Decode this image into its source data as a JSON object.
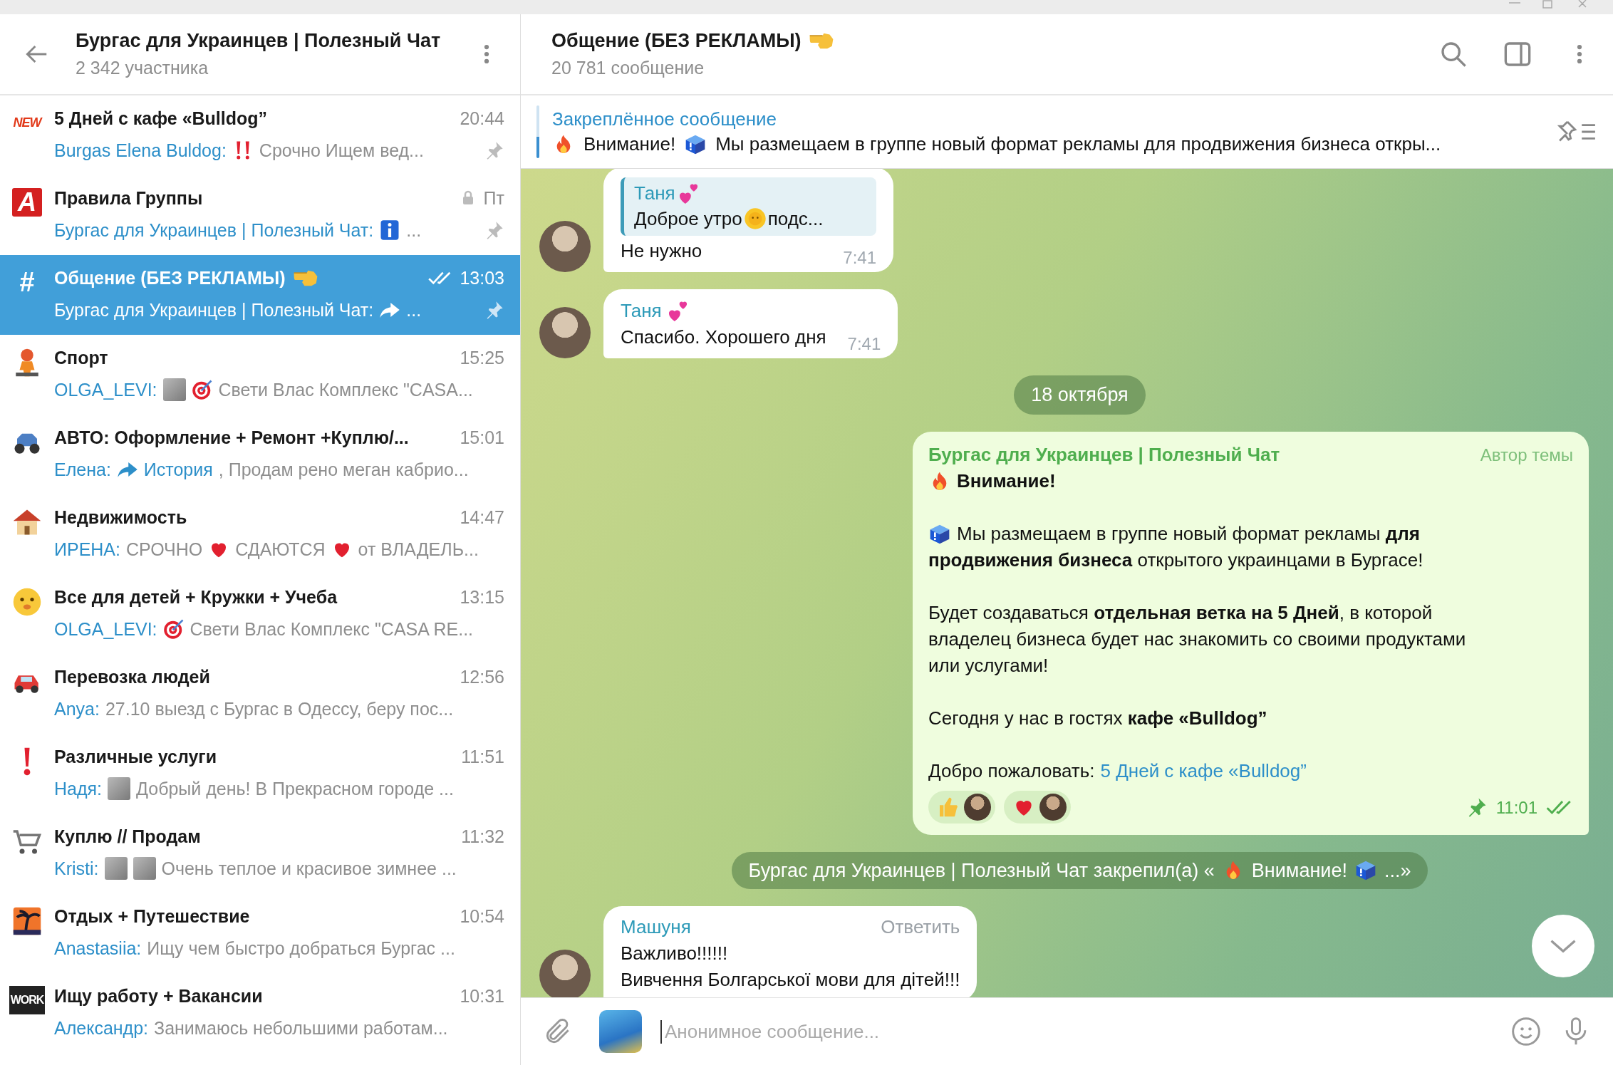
{
  "sidebar_header": {
    "title": "Бургас для Украинцев | Полезный Чат",
    "subtitle": "2 342 участника"
  },
  "topics": [
    {
      "icon_text": "NEW",
      "title": "5 Дней с кафе «Bulldog”",
      "time": "20:44",
      "sender": "Burgas Elena Buldog:",
      "preview": [
        {
          "kind": "exclaim"
        },
        {
          "kind": "text",
          "text": "Срочно Ищем вед..."
        }
      ],
      "pinned": true,
      "locked": false,
      "read": false,
      "selected": false
    },
    {
      "icon_text": "A",
      "title": "Правила Группы",
      "time": "Пт",
      "sender": "Бургас для Украинцев | Полезный Чат:",
      "preview": [
        {
          "kind": "info"
        },
        {
          "kind": "text",
          "text": "..."
        }
      ],
      "pinned": true,
      "locked": true,
      "read": false,
      "selected": false
    },
    {
      "icon_text": "#",
      "title": "Общение (БЕЗ РЕКЛАМЫ)",
      "title_icon": true,
      "time": "13:03",
      "sender": "Бургас для Украинцев | Полезный Чат:",
      "preview": [
        {
          "kind": "forward"
        },
        {
          "kind": "text",
          "text": "..."
        }
      ],
      "pinned": true,
      "locked": false,
      "read": true,
      "selected": true
    },
    {
      "title": "Спорт",
      "time": "15:25",
      "sender": "OLGA_LEVI:",
      "preview": [
        {
          "kind": "photo"
        },
        {
          "kind": "target"
        },
        {
          "kind": "text",
          "text": "Свети Влас  Комплекс \"CASA..."
        }
      ],
      "pinned": false,
      "locked": false,
      "read": false,
      "selected": false
    },
    {
      "title": "АВТО: Оформление + Ремонт +Куплю/...",
      "time": "15:01",
      "sender": "Елена:",
      "preview": [
        {
          "kind": "forward"
        },
        {
          "kind": "link",
          "text": "История"
        },
        {
          "kind": "text",
          "text": ", Продам рено меган кабрио..."
        }
      ],
      "pinned": false,
      "locked": false,
      "read": false,
      "selected": false
    },
    {
      "title": "Недвижимость",
      "time": "14:47",
      "sender": "ИРЕНА:",
      "preview": [
        {
          "kind": "text",
          "text": "СРОЧНО"
        },
        {
          "kind": "heart"
        },
        {
          "kind": "text",
          "text": "СДАЮТСЯ"
        },
        {
          "kind": "heart"
        },
        {
          "kind": "text",
          "text": "от  ВЛАДЕЛЬ..."
        }
      ],
      "pinned": false,
      "locked": false,
      "read": false,
      "selected": false
    },
    {
      "title": "Все для детей + Кружки + Учеба",
      "time": "13:15",
      "sender": "OLGA_LEVI:",
      "preview": [
        {
          "kind": "target"
        },
        {
          "kind": "text",
          "text": "Свети Влас  Комплекс \"CASA RE..."
        }
      ],
      "pinned": false,
      "locked": false,
      "read": false,
      "selected": false
    },
    {
      "title": "Перевозка людей",
      "time": "12:56",
      "sender": "Anya:",
      "preview": [
        {
          "kind": "text",
          "text": "27.10 выезд  с Бургас в Одессу, беру пос..."
        }
      ],
      "pinned": false,
      "locked": false,
      "read": false,
      "selected": false
    },
    {
      "title": "Различные услуги",
      "time": "11:51",
      "sender": "Надя:",
      "preview": [
        {
          "kind": "photo"
        },
        {
          "kind": "text",
          "text": "Добрый день! В Прекрасном городе ..."
        }
      ],
      "pinned": false,
      "locked": false,
      "read": false,
      "selected": false
    },
    {
      "title": "Куплю // Продам",
      "time": "11:32",
      "sender": "Kristi:",
      "preview": [
        {
          "kind": "photo"
        },
        {
          "kind": "photo"
        },
        {
          "kind": "text",
          "text": "Очень теплое и красивое зимнее ..."
        }
      ],
      "pinned": false,
      "locked": false,
      "read": false,
      "selected": false
    },
    {
      "title": "Отдых + Путешествие",
      "time": "10:54",
      "sender": "Anastasiia:",
      "preview": [
        {
          "kind": "text",
          "text": "Ищу чем быстро добраться Бургас ..."
        }
      ],
      "pinned": false,
      "locked": false,
      "read": false,
      "selected": false
    },
    {
      "icon_text": "WORK",
      "title": "Ищу работу + Вакансии",
      "time": "10:31",
      "sender": "Александр:",
      "preview": [
        {
          "kind": "text",
          "text": "Занимаюсь небольшими работам..."
        }
      ],
      "pinned": false,
      "locked": false,
      "read": false,
      "selected": false
    }
  ],
  "chat_header": {
    "title": "Общение (БЕЗ РЕКЛАМЫ)",
    "title_icon": true,
    "subtitle": "20 781 сообщение"
  },
  "pinned_message": {
    "label": "Закреплённое сообщение",
    "parts": [
      {
        "kind": "fire"
      },
      {
        "kind": "text",
        "text": "Внимание!"
      },
      {
        "kind": "box"
      },
      {
        "kind": "text",
        "text": "Мы размещаем в группе новый формат рекламы для продвижения бизнеса откры..."
      }
    ]
  },
  "messages": [
    {
      "kind": "incoming",
      "reply": {
        "author": "Таня",
        "author_icon": true,
        "parts": [
          {
            "kind": "text",
            "text": "Доброе утро"
          },
          {
            "kind": "sun"
          },
          {
            "kind": "text",
            "text": "подс..."
          }
        ]
      },
      "lines": [
        "Не нужно"
      ],
      "time": "7:41"
    },
    {
      "kind": "incoming",
      "author": "Таня",
      "author_icon": true,
      "lines": [
        "Спасибо. Хорошего дня"
      ],
      "time": "7:41"
    },
    {
      "kind": "date",
      "text": "18 октября"
    },
    {
      "kind": "post",
      "author": "Бургас для Украинцев | Полезный Чат",
      "badge": "Автор темы",
      "paragraphs": [
        [
          [
            {
              "kind": "fire"
            },
            {
              "kind": "strong",
              "text": "Внимание!"
            }
          ]
        ],
        [
          [
            {
              "kind": "box"
            },
            {
              "kind": "text",
              "text": "Мы размещаем в группе новый формат рекламы **для**"
            }
          ],
          [
            {
              "kind": "text",
              "text": "**продвижения бизнеса** открытого украинцами в Бургасе!"
            }
          ]
        ],
        [
          [
            {
              "kind": "text",
              "text": "Будет создаваться **отдельная ветка на 5 Дней**, в которой"
            }
          ],
          [
            {
              "kind": "text",
              "text": "владелец бизнеса будет нас знакомить со своими продуктами"
            }
          ],
          [
            {
              "kind": "text",
              "text": "или услугами!"
            }
          ]
        ],
        [
          [
            {
              "kind": "text",
              "text": "Сегодня у нас в гостях **кафе «Bulldog”**"
            }
          ]
        ],
        [
          [
            {
              "kind": "text",
              "text": "Добро пожаловать:"
            },
            {
              "kind": "link",
              "text": "5 Дней с кафе «Bulldog”"
            }
          ]
        ]
      ],
      "reactions": [
        {
          "kind": "thumb"
        },
        {
          "kind": "heart"
        }
      ],
      "time": "11:01",
      "pinned": true,
      "read": true
    },
    {
      "kind": "service",
      "parts": [
        {
          "kind": "text",
          "text": "Бургас для Украинцев | Полезный Чат закрепил(а) «"
        },
        {
          "kind": "fire"
        },
        {
          "kind": "text",
          "text": "Внимание!"
        },
        {
          "kind": "box"
        },
        {
          "kind": "text",
          "text": "...»"
        }
      ]
    },
    {
      "kind": "incoming",
      "author": "Машуня",
      "action": "Ответить",
      "lines": [
        "Важливо!!!!!!",
        "Вивчення Болгарської мови для дітей!!!"
      ]
    }
  ],
  "composer": {
    "placeholder": "Анонимное сообщение..."
  }
}
